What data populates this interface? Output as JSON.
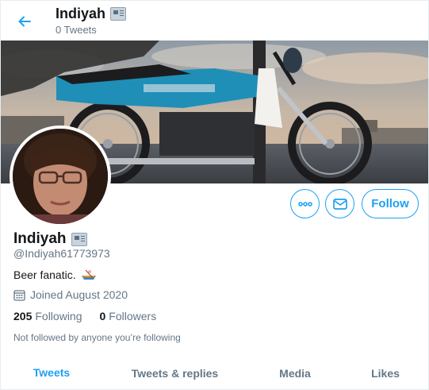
{
  "header": {
    "display_name": "Indiyah",
    "tweet_count": "0 Tweets"
  },
  "profile": {
    "display_name": "Indiyah",
    "handle": "@Indiyah61773973",
    "bio": "Beer fanatic.",
    "joined": "Joined August 2020",
    "following_count": "205",
    "following_label": "Following",
    "followers_count": "0",
    "followers_label": "Followers",
    "not_followed_text": "Not followed by anyone you’re following"
  },
  "actions": {
    "more_icon": "more-options-icon",
    "mail_icon": "envelope-icon",
    "follow_label": "Follow"
  },
  "tabs": [
    {
      "label": "Tweets",
      "active": true
    },
    {
      "label": "Tweets & replies",
      "active": false
    },
    {
      "label": "Media",
      "active": false
    },
    {
      "label": "Likes",
      "active": false
    }
  ],
  "colors": {
    "accent": "#1da1f2",
    "secondary_text": "#657786",
    "primary_text": "#14171a"
  }
}
